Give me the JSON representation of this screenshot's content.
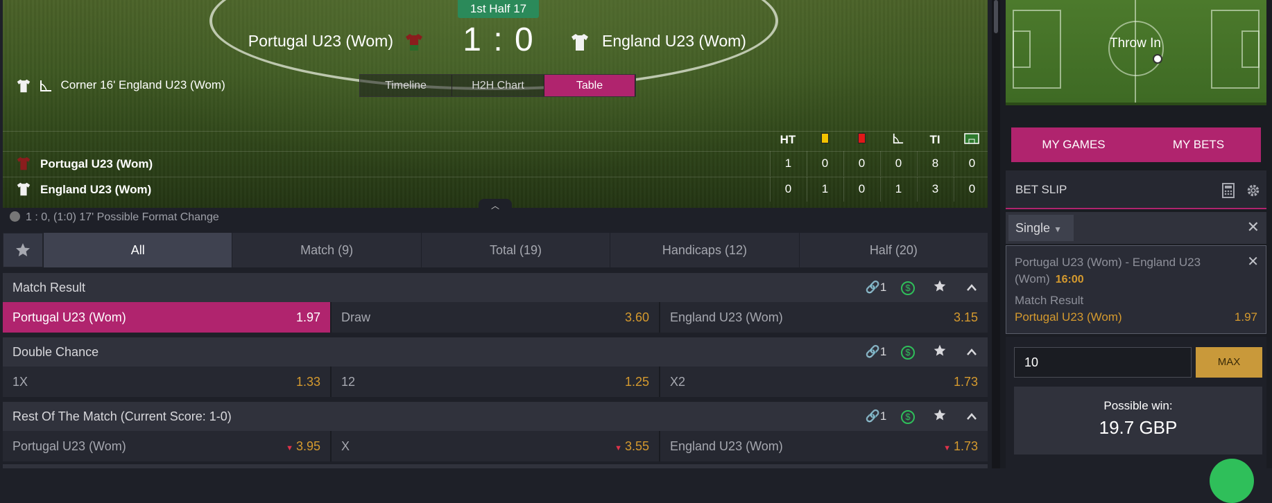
{
  "scoreboard": {
    "period": "1st Half 17",
    "home_team": "Portugal U23 (Wom)",
    "away_team": "England U23 (Wom)",
    "score": "1 : 0",
    "last_event": "Corner 16' England U23 (Wom)",
    "view_tabs": [
      "Timeline",
      "H2H Chart",
      "Table"
    ],
    "active_view": "Table",
    "stat_headers": [
      "HT",
      "yellow-card-icon",
      "red-card-icon",
      "corner-icon",
      "TI",
      "goal-kick-icon"
    ],
    "stat_header_labels": {
      "ht": "HT",
      "ti": "TI"
    },
    "rows": [
      {
        "team": "Portugal U23 (Wom)",
        "values": [
          "1",
          "0",
          "0",
          "0",
          "8",
          "0"
        ]
      },
      {
        "team": "England U23 (Wom)",
        "values": [
          "0",
          "1",
          "0",
          "1",
          "3",
          "0"
        ]
      }
    ]
  },
  "info_line": "1 : 0, (1:0) 17' Possible Format Change",
  "market_tabs": [
    "All",
    "Match (9)",
    "Total (19)",
    "Handicaps (12)",
    "Half (20)"
  ],
  "active_market_tab": "All",
  "markets": [
    {
      "title": "Match Result",
      "link_count": "1",
      "odds": [
        {
          "label": "Portugal U23 (Wom)",
          "value": "1.97",
          "selected": true
        },
        {
          "label": "Draw",
          "value": "3.60"
        },
        {
          "label": "England U23 (Wom)",
          "value": "3.15"
        }
      ]
    },
    {
      "title": "Double Chance",
      "link_count": "1",
      "odds": [
        {
          "label": "1X",
          "value": "1.33"
        },
        {
          "label": "12",
          "value": "1.25"
        },
        {
          "label": "X2",
          "value": "1.73"
        }
      ]
    },
    {
      "title": "Rest Of The Match (Current Score: 1-0)",
      "link_count": "1",
      "odds": [
        {
          "label": "Portugal U23 (Wom)",
          "value": "3.95",
          "trend": "down"
        },
        {
          "label": "X",
          "value": "3.55",
          "trend": "down"
        },
        {
          "label": "England U23 (Wom)",
          "value": "1.73",
          "trend": "down"
        }
      ]
    }
  ],
  "right": {
    "pitch_event": "Throw In",
    "my_games": "MY GAMES",
    "my_bets": "MY BETS",
    "bet_slip": "BET SLIP",
    "bet_type": "Single",
    "slip": {
      "match": "Portugal U23 (Wom) - England U23 (Wom)",
      "time": "16:00",
      "market": "Match Result",
      "pick": "Portugal U23 (Wom)",
      "odds": "1.97"
    },
    "stake": "10",
    "max_label": "MAX",
    "possible_label": "Possible win:",
    "possible_value": "19.7 GBP"
  },
  "colors": {
    "accent": "#b0246e",
    "odds": "#d59a2e",
    "period": "#2b8a5a"
  }
}
